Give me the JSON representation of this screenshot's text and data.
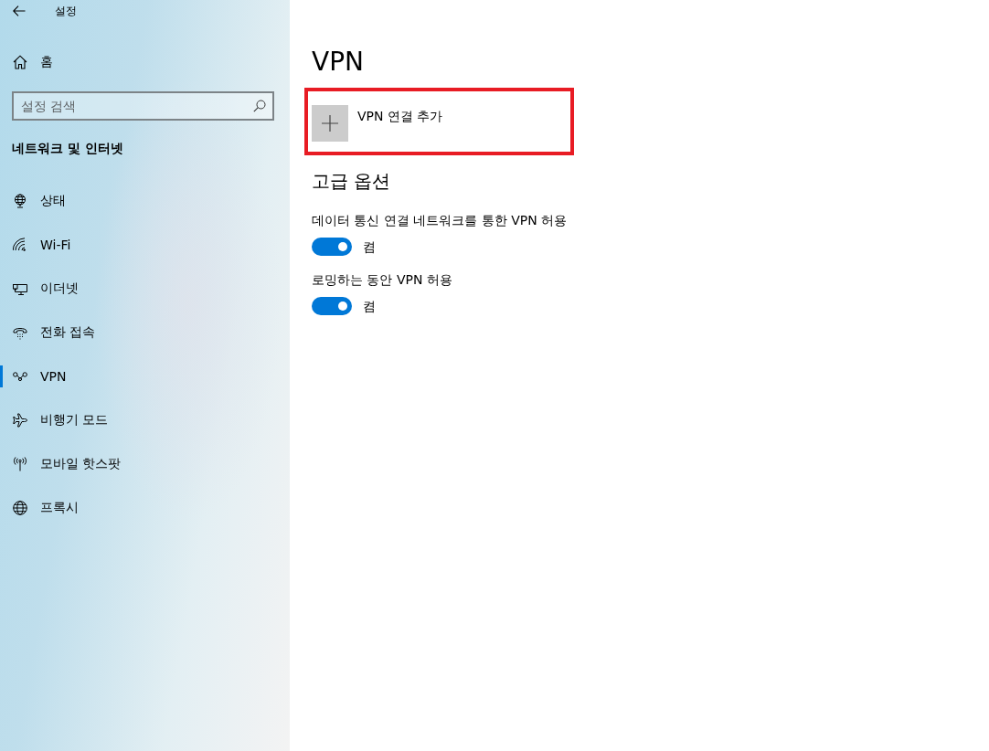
{
  "window": {
    "title": "설정"
  },
  "sidebar": {
    "home": "홈",
    "search": {
      "placeholder": "설정 검색"
    },
    "section": "네트워크 및 인터넷",
    "items": [
      {
        "label": "상태",
        "selected": false
      },
      {
        "label": "Wi-Fi",
        "selected": false
      },
      {
        "label": "이더넷",
        "selected": false
      },
      {
        "label": "전화 접속",
        "selected": false
      },
      {
        "label": "VPN",
        "selected": true
      },
      {
        "label": "비행기 모드",
        "selected": false
      },
      {
        "label": "모바일 핫스팟",
        "selected": false
      },
      {
        "label": "프록시",
        "selected": false
      }
    ]
  },
  "main": {
    "title": "VPN",
    "add_connection": {
      "label": "VPN 연결 추가",
      "highlighted": true
    },
    "section": "고급 옵션",
    "options": [
      {
        "label": "데이터 통신 연결 네트워크를 통한 VPN 허용",
        "on": true,
        "state_label": "켬"
      },
      {
        "label": "로밍하는 동안 VPN 허용",
        "on": true,
        "state_label": "켬"
      }
    ]
  }
}
